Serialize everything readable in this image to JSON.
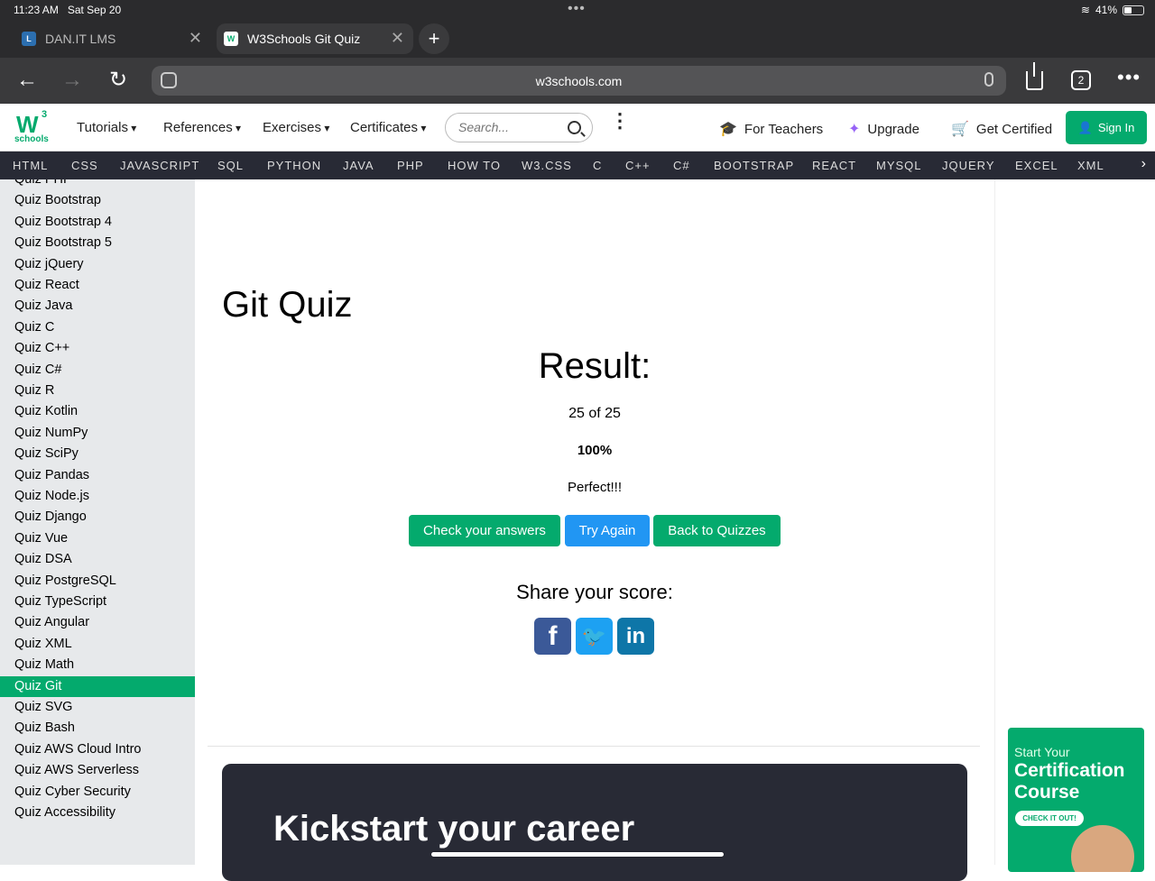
{
  "status": {
    "time": "11:23 AM",
    "date": "Sat Sep 20",
    "battery": "41%",
    "battery_level": 0.41
  },
  "browser": {
    "tabs": [
      {
        "title": "DAN.IT LMS",
        "favicon": "L"
      },
      {
        "title": "W3Schools Git Quiz",
        "favicon": "W"
      }
    ],
    "url": "w3schools.com",
    "tab_count": "2"
  },
  "header": {
    "logo_main": "W",
    "logo_sup": "3",
    "logo_sub": "schools",
    "menus": [
      "Tutorials",
      "References",
      "Exercises",
      "Certificates"
    ],
    "search_placeholder": "Search...",
    "links": {
      "teachers": "For Teachers",
      "upgrade": "Upgrade",
      "certified": "Get Certified"
    },
    "signin": "Sign In"
  },
  "topnav": [
    "HTML",
    "CSS",
    "JAVASCRIPT",
    "SQL",
    "PYTHON",
    "JAVA",
    "PHP",
    "HOW TO",
    "W3.CSS",
    "C",
    "C++",
    "C#",
    "BOOTSTRAP",
    "REACT",
    "MYSQL",
    "JQUERY",
    "EXCEL",
    "XML"
  ],
  "sidebar": {
    "items": [
      "Quiz PHP",
      "Quiz Bootstrap",
      "Quiz Bootstrap 4",
      "Quiz Bootstrap 5",
      "Quiz jQuery",
      "Quiz React",
      "Quiz Java",
      "Quiz C",
      "Quiz C++",
      "Quiz C#",
      "Quiz R",
      "Quiz Kotlin",
      "Quiz NumPy",
      "Quiz SciPy",
      "Quiz Pandas",
      "Quiz Node.js",
      "Quiz Django",
      "Quiz Vue",
      "Quiz DSA",
      "Quiz PostgreSQL",
      "Quiz TypeScript",
      "Quiz Angular",
      "Quiz XML",
      "Quiz Math",
      "Quiz Git",
      "Quiz SVG",
      "Quiz Bash",
      "Quiz AWS Cloud Intro",
      "Quiz AWS Serverless",
      "Quiz Cyber Security",
      "Quiz Accessibility"
    ],
    "active": "Quiz Git"
  },
  "main": {
    "title": "Git Quiz",
    "result_heading": "Result:",
    "score": "25 of 25",
    "percent": "100%",
    "verdict": "Perfect!!!",
    "buttons": {
      "check": "Check your answers",
      "again": "Try Again",
      "back": "Back to Quizzes"
    },
    "share_heading": "Share your score:",
    "banner": "Kickstart your career"
  },
  "ad": {
    "line1": "Start Your",
    "line2": "Certification Course",
    "cta": "CHECK IT OUT!"
  },
  "colors": {
    "brand": "#04aa6d",
    "nav_dark": "#282a35",
    "blue": "#2196f3"
  }
}
